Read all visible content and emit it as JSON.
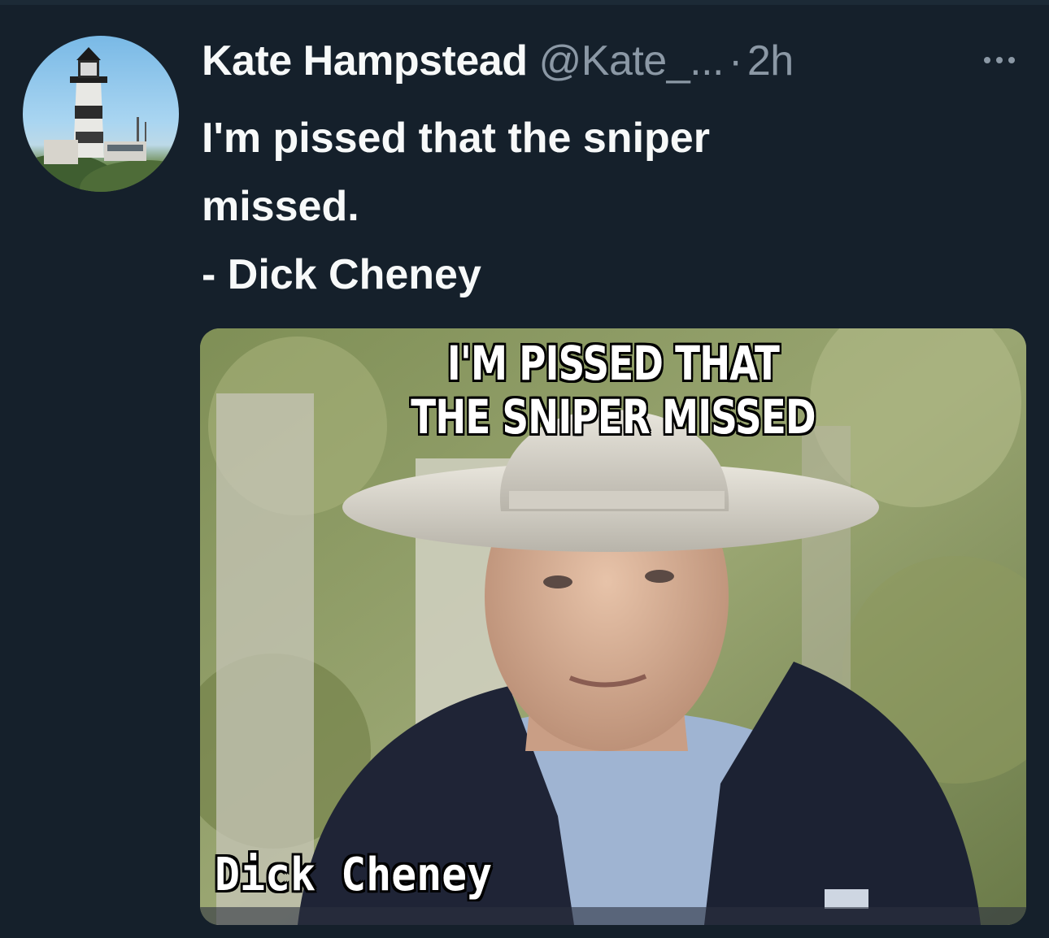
{
  "tweet": {
    "author": {
      "display_name": "Kate Hampstead",
      "handle": "@Kate_...",
      "avatar_icon": "lighthouse-avatar"
    },
    "separator": "·",
    "timestamp": "2h",
    "more_icon": "more-dots-icon",
    "text_lines": [
      "I'm pissed that the sniper",
      "missed.",
      "- Dick Cheney"
    ],
    "media": {
      "caption_lines": [
        "I'M PISSED THAT",
        "THE SNIPER MISSED"
      ],
      "name_label": "Dick Cheney"
    }
  },
  "colors": {
    "background": "#15202b",
    "primary_text": "#f7f9f9",
    "secondary_text": "#8b98a5"
  }
}
